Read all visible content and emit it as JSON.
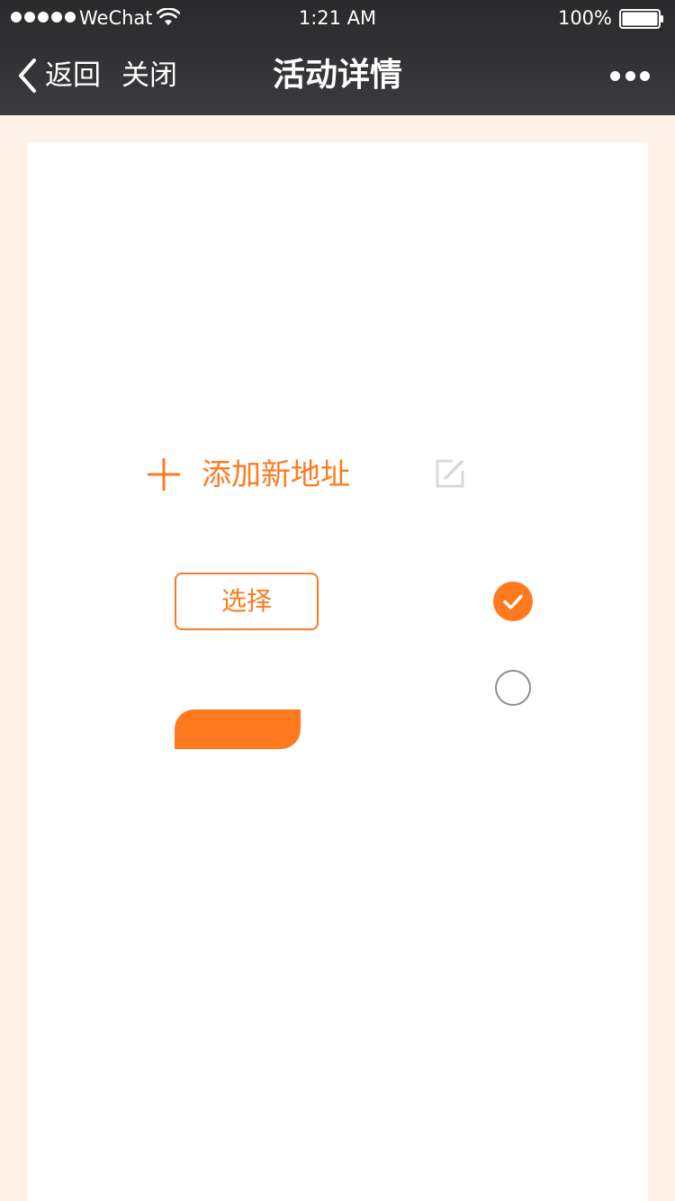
{
  "status_bar": {
    "carrier": "WeChat",
    "time": "1:21 AM",
    "battery": "100%"
  },
  "nav_bar": {
    "back_label": "返回",
    "close_label": "关闭",
    "title": "活动详情"
  },
  "content": {
    "add_address_label": "添加新地址",
    "select_button_label": "选择",
    "radio_options": [
      {
        "checked": true
      },
      {
        "checked": false
      }
    ]
  },
  "colors": {
    "accent": "#ff7a1e",
    "nav_background": "#333335",
    "page_background": "#fff2e8",
    "panel_background": "#ffffff",
    "radio_border": "#8e8e8e",
    "edit_icon": "#d9d9d9"
  },
  "icons": {
    "signal": "signal-dots-icon",
    "wifi": "wifi-icon",
    "battery": "battery-icon",
    "back": "chevron-left-icon",
    "more": "more-dots-icon",
    "add": "plus-icon",
    "edit": "edit-icon",
    "radio_checked": "check-circle-icon",
    "radio_unchecked": "empty-circle-icon"
  }
}
